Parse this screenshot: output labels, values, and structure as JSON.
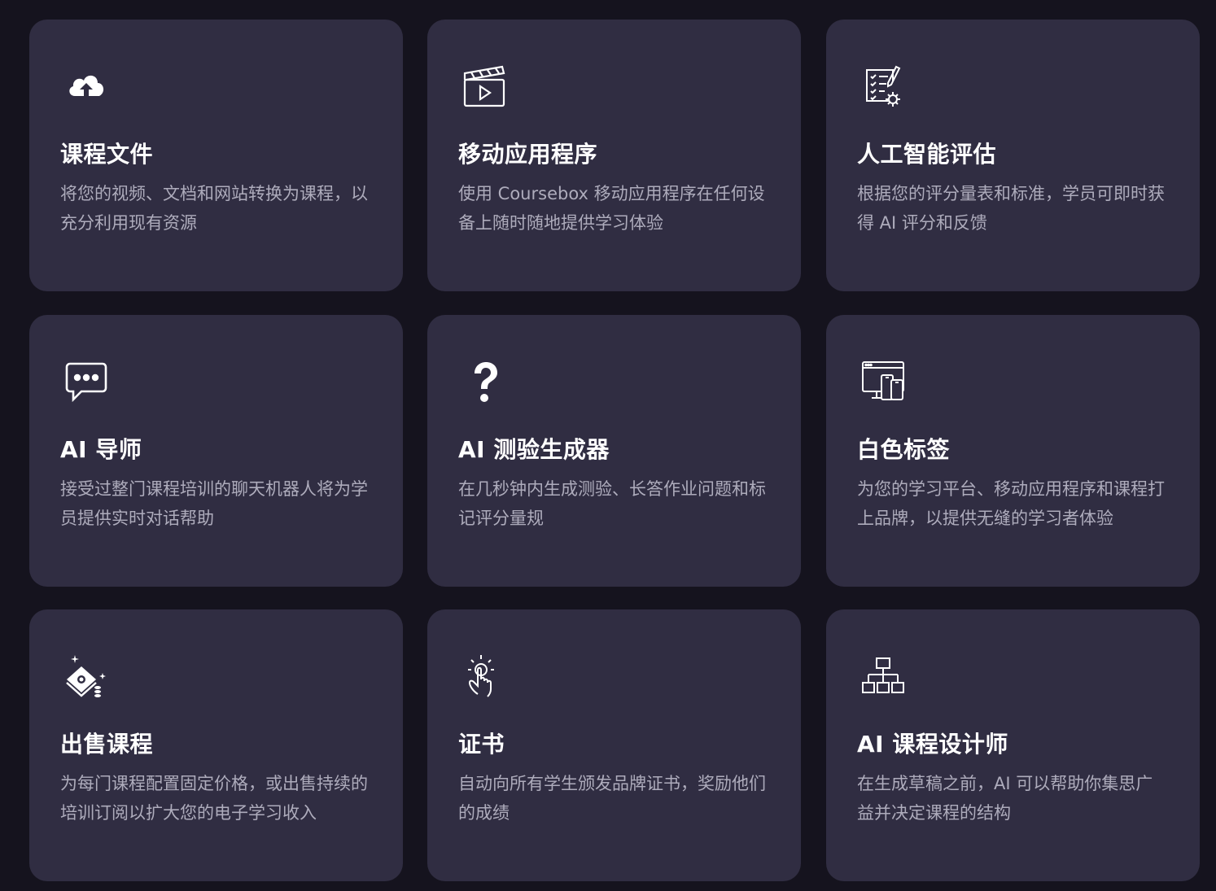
{
  "cards": [
    {
      "icon": "cloud-upload-icon",
      "title": "课程文件",
      "desc": "将您的视频、文档和网站转换为课程，以充分利用现有资源"
    },
    {
      "icon": "video-clapper-icon",
      "title": "移动应用程序",
      "desc": "使用 Coursebox 移动应用程序在任何设备上随时随地提供学习体验"
    },
    {
      "icon": "checklist-gear-icon",
      "title": "人工智能评估",
      "desc": "根据您的评分量表和标准，学员可即时获得 AI 评分和反馈"
    },
    {
      "icon": "chat-bubble-icon",
      "title": "AI 导师",
      "desc": "接受过整门课程培训的聊天机器人将为学员提供实时对话帮助"
    },
    {
      "icon": "question-mark-icon",
      "title": "AI 测验生成器",
      "desc": "在几秒钟内生成测验、长答作业问题和标记评分量规"
    },
    {
      "icon": "multi-device-icon",
      "title": "白色标签",
      "desc": "为您的学习平台、移动应用程序和课程打上品牌，以提供无缝的学习者体验"
    },
    {
      "icon": "money-coins-icon",
      "title": "出售课程",
      "desc": "为每门课程配置固定价格，或出售持续的培训订阅以扩大您的电子学习收入"
    },
    {
      "icon": "tap-hand-icon",
      "title": "证书",
      "desc": "自动向所有学生颁发品牌证书，奖励他们的成绩"
    },
    {
      "icon": "org-chart-icon",
      "title": "AI 课程设计师",
      "desc": "在生成草稿之前，AI 可以帮助你集思广益并决定课程的结构"
    }
  ]
}
